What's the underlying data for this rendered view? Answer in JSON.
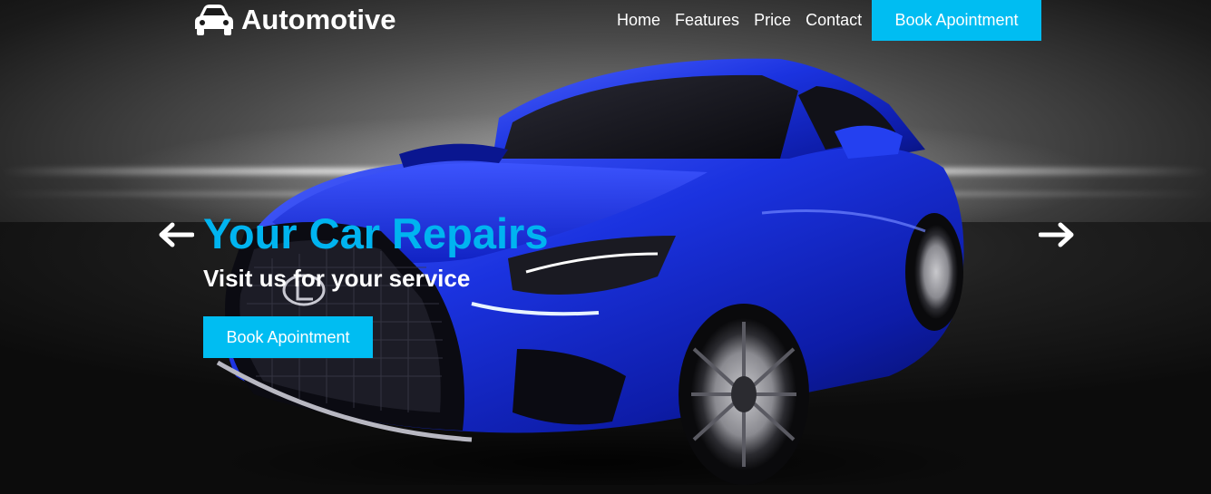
{
  "brand": {
    "name": "Automotive",
    "icon": "car-icon"
  },
  "nav": {
    "links": [
      "Home",
      "Features",
      "Price",
      "Contact"
    ],
    "cta_label": "Book Apointment"
  },
  "hero": {
    "headline": "Your Car Repairs",
    "subheadline": "Visit us for your service",
    "cta_label": "Book Apointment",
    "prev_icon": "arrow-left-icon",
    "next_icon": "arrow-right-icon",
    "image": "blue-sports-car"
  },
  "colors": {
    "accent": "#00bdf2",
    "headline": "#00b4f0",
    "car_body": "#1a2fd8",
    "text": "#ffffff"
  }
}
